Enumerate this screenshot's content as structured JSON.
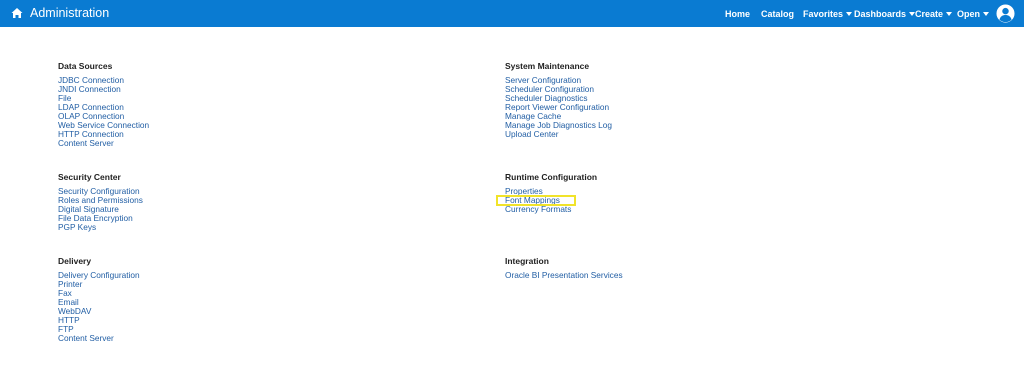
{
  "header": {
    "title": "Administration",
    "nav": {
      "home": "Home",
      "catalog": "Catalog",
      "favorites": "Favorites",
      "dashboards": "Dashboards",
      "create": "Create",
      "open": "Open"
    },
    "accent_color": "#0a7bd2"
  },
  "sections": {
    "data_sources": {
      "title": "Data Sources",
      "items": [
        "JDBC Connection",
        "JNDI Connection",
        "File",
        "LDAP Connection",
        "OLAP Connection",
        "Web Service Connection",
        "HTTP Connection",
        "Content Server"
      ]
    },
    "security_center": {
      "title": "Security Center",
      "items": [
        "Security Configuration",
        "Roles and Permissions",
        "Digital Signature",
        "File Data Encryption",
        "PGP Keys"
      ]
    },
    "delivery": {
      "title": "Delivery",
      "items": [
        "Delivery Configuration",
        "Printer",
        "Fax",
        "Email",
        "WebDAV",
        "HTTP",
        "FTP",
        "Content Server"
      ]
    },
    "system_maintenance": {
      "title": "System Maintenance",
      "items": [
        "Server Configuration",
        "Scheduler Configuration",
        "Scheduler Diagnostics",
        "Report Viewer Configuration",
        "Manage Cache",
        "Manage Job Diagnostics Log",
        "Upload Center"
      ]
    },
    "runtime_configuration": {
      "title": "Runtime Configuration",
      "items": [
        "Properties",
        "Font Mappings",
        "Currency Formats"
      ]
    },
    "integration": {
      "title": "Integration",
      "items": [
        "Oracle BI Presentation Services"
      ]
    }
  },
  "link_color": "#215ea4",
  "highlight_color": "#f1e32a"
}
